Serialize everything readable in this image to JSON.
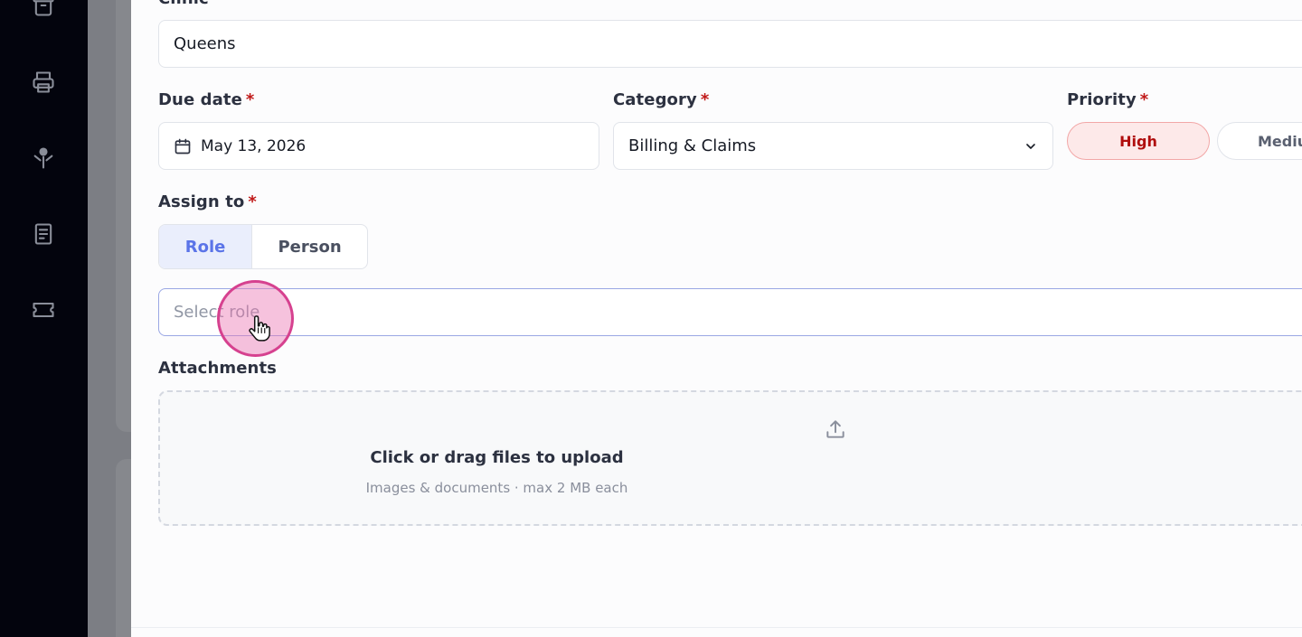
{
  "sidebar": {
    "icons": [
      "archive-icon",
      "printer-icon",
      "user-pin-icon",
      "document-icon",
      "ticket-icon"
    ]
  },
  "form": {
    "clinic": {
      "label": "Clinic",
      "value": "Queens"
    },
    "due_date": {
      "label": "Due date",
      "required_mark": "*",
      "value": "May 13, 2026"
    },
    "category": {
      "label": "Category",
      "required_mark": "*",
      "value": "Billing & Claims"
    },
    "priority": {
      "label": "Priority",
      "required_mark": "*",
      "options": [
        "High",
        "Mediu"
      ],
      "selected": "High"
    },
    "assign_to": {
      "label": "Assign to",
      "required_mark": "*",
      "modes": [
        "Role",
        "Person"
      ],
      "selected_mode": "Role",
      "role_placeholder": "Select role"
    },
    "attachments": {
      "label": "Attachments",
      "upload_title": "Click or drag files to upload",
      "upload_hint": "Images & documents · max 2 MB each"
    }
  },
  "colors": {
    "accent": "#5b74e8",
    "required": "#c01818",
    "priority_high_bg": "#fde9e9",
    "priority_high_text": "#b00d0d",
    "cursor": "#d6418f"
  }
}
